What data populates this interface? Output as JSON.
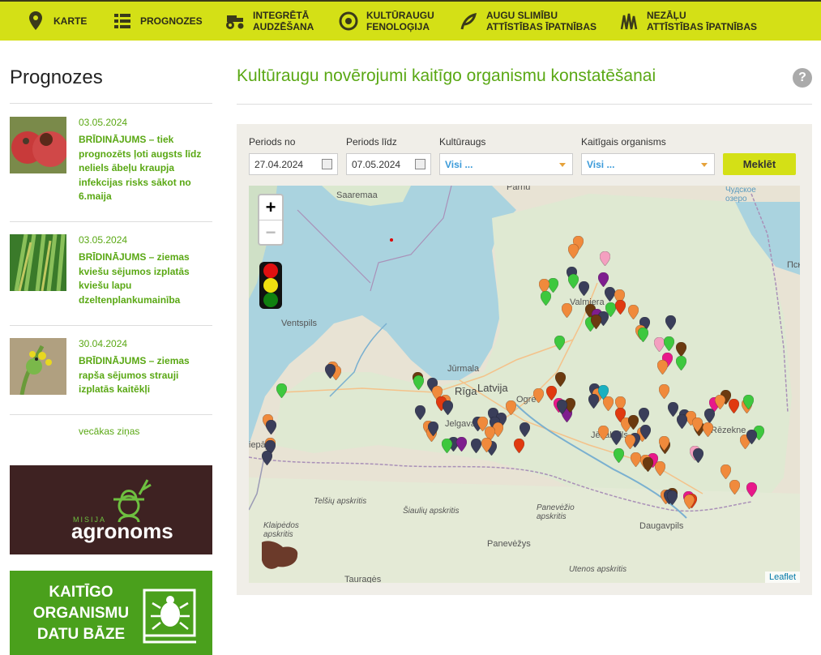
{
  "nav": [
    {
      "label": "KARTE",
      "icon": "map-pin-icon"
    },
    {
      "label": "PROGNOZES",
      "icon": "list-icon"
    },
    {
      "label": "INTEGRĒTĀ\nAUDZĒŠANA",
      "icon": "tractor-icon"
    },
    {
      "label": "KULTŪRAUGU\nFENOLOĢIJA",
      "icon": "seed-icon"
    },
    {
      "label": "AUGU SLIMĪBU\nATTĪSTĪBAS ĪPATNĪBAS",
      "icon": "leaf-sprout-icon"
    },
    {
      "label": "NEZĀĻU\nATTĪSTĪBAS ĪPATNĪBAS",
      "icon": "grass-icon"
    }
  ],
  "sidebar": {
    "title": "Prognozes",
    "news": [
      {
        "date": "03.05.2024",
        "text": "BRĪDINĀJUMS – tiek prognozēts ļoti augsts līdz neliels ābeļu kraupja infekcijas risks sākot no 6.maija"
      },
      {
        "date": "03.05.2024",
        "text": "BRĪDINĀJUMS – ziemas kviešu sējumos izplatās kviešu lapu dzeltenplankumainība"
      },
      {
        "date": "30.04.2024",
        "text": "BRĪDINĀJUMS – ziemas rapša sējumos strauji izplatās kaitēkļi"
      }
    ],
    "older_link": "vecākas ziņas",
    "banner1": {
      "small": "MISIJA",
      "big": "agronoms"
    },
    "banner2": {
      "line1": "KAITĪGO",
      "line2": "ORGANISMU",
      "line3": "DATU BĀZE"
    }
  },
  "main": {
    "title": "Kultūraugu novērojumi kaitīgo organismu konstatēšanai",
    "help": "?"
  },
  "filters": {
    "period_from_label": "Periods no",
    "period_from": "27.04.2024",
    "period_to_label": "Periods līdz",
    "period_to": "07.05.2024",
    "crop_label": "Kultūraugs",
    "crop_value": "Visi ...",
    "organism_label": "Kaitīgais organisms",
    "organism_value": "Visi ...",
    "search_button": "Meklēt"
  },
  "map": {
    "zoom_in": "+",
    "zoom_out": "−",
    "attribution": "Leaflet",
    "labels": {
      "saaremaa": "Saaremaa",
      "parnu": "Pärnu",
      "lake": "Чудское озеро",
      "psk": "Пск",
      "ventspils": "Ventspils",
      "valmiera": "Valmiera",
      "jurmala": "Jūrmala",
      "riga": "Rīga",
      "latvija": "Latvija",
      "ogre": "Ogre",
      "jelgava": "Jelgava",
      "liepaja": "iepāja",
      "jekabpils": "Jēkabpils",
      "rezekne": "Rēzekne",
      "telsiu": "Telšių apskritis",
      "siauliu": "Šiaulių apskritis",
      "panevezio": "Panevėžio apskritis",
      "klaipedos": "Klaipėdos apskritis",
      "panevezys": "Panevėžys",
      "utenos": "Utenos apskritis",
      "daugavpils": "Daugavpils",
      "taurages": "Tauragės"
    },
    "traffic_colors": [
      "#e01010",
      "#f0e010",
      "#108010"
    ],
    "marker_colors": {
      "orange": "#f08a3c",
      "navy": "#3a3e5a",
      "green": "#3ec83e",
      "purple": "#7e1e8e",
      "brown": "#6b3a10",
      "pink": "#e8188a",
      "red": "#e03a10",
      "teal": "#1ab0c0",
      "lightpink": "#f4a0c0"
    }
  }
}
